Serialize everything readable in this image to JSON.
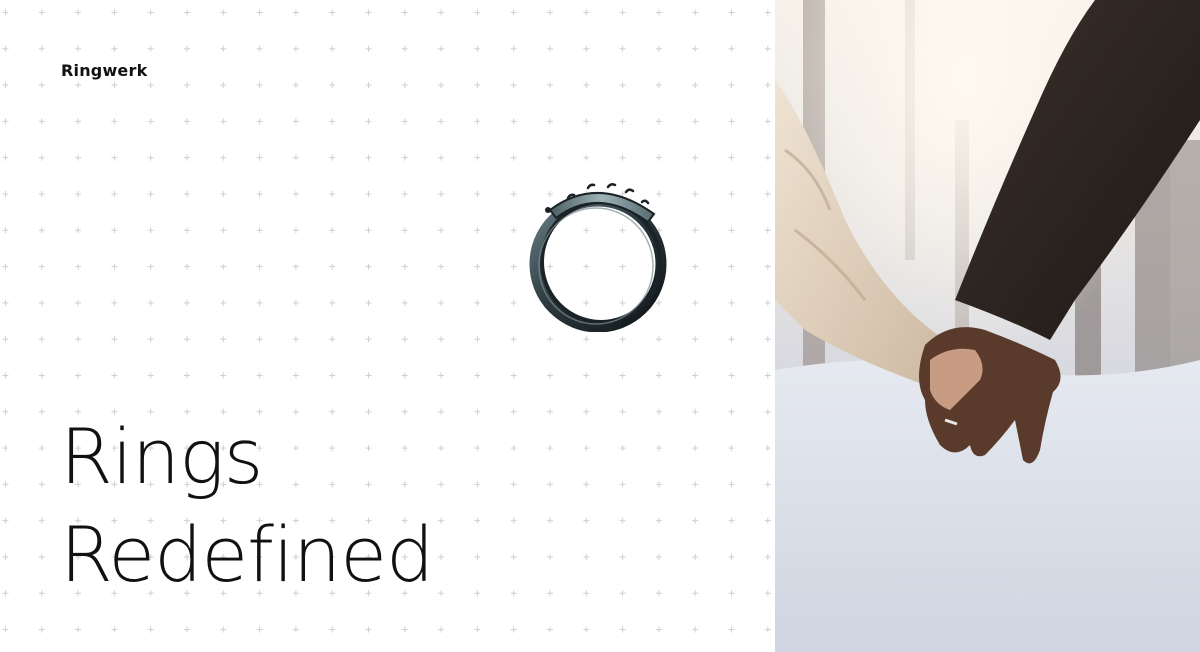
{
  "brand": {
    "name": "Ringwerk"
  },
  "hero": {
    "headline_line1": "Rings",
    "headline_line2": "Redefined"
  },
  "product_image": {
    "icon": "smart-ring"
  },
  "photo": {
    "subject": "two-people-holding-hands-snow"
  },
  "colors": {
    "background": "#ffffff",
    "text": "#111111",
    "grid": "#c9c9c9"
  }
}
